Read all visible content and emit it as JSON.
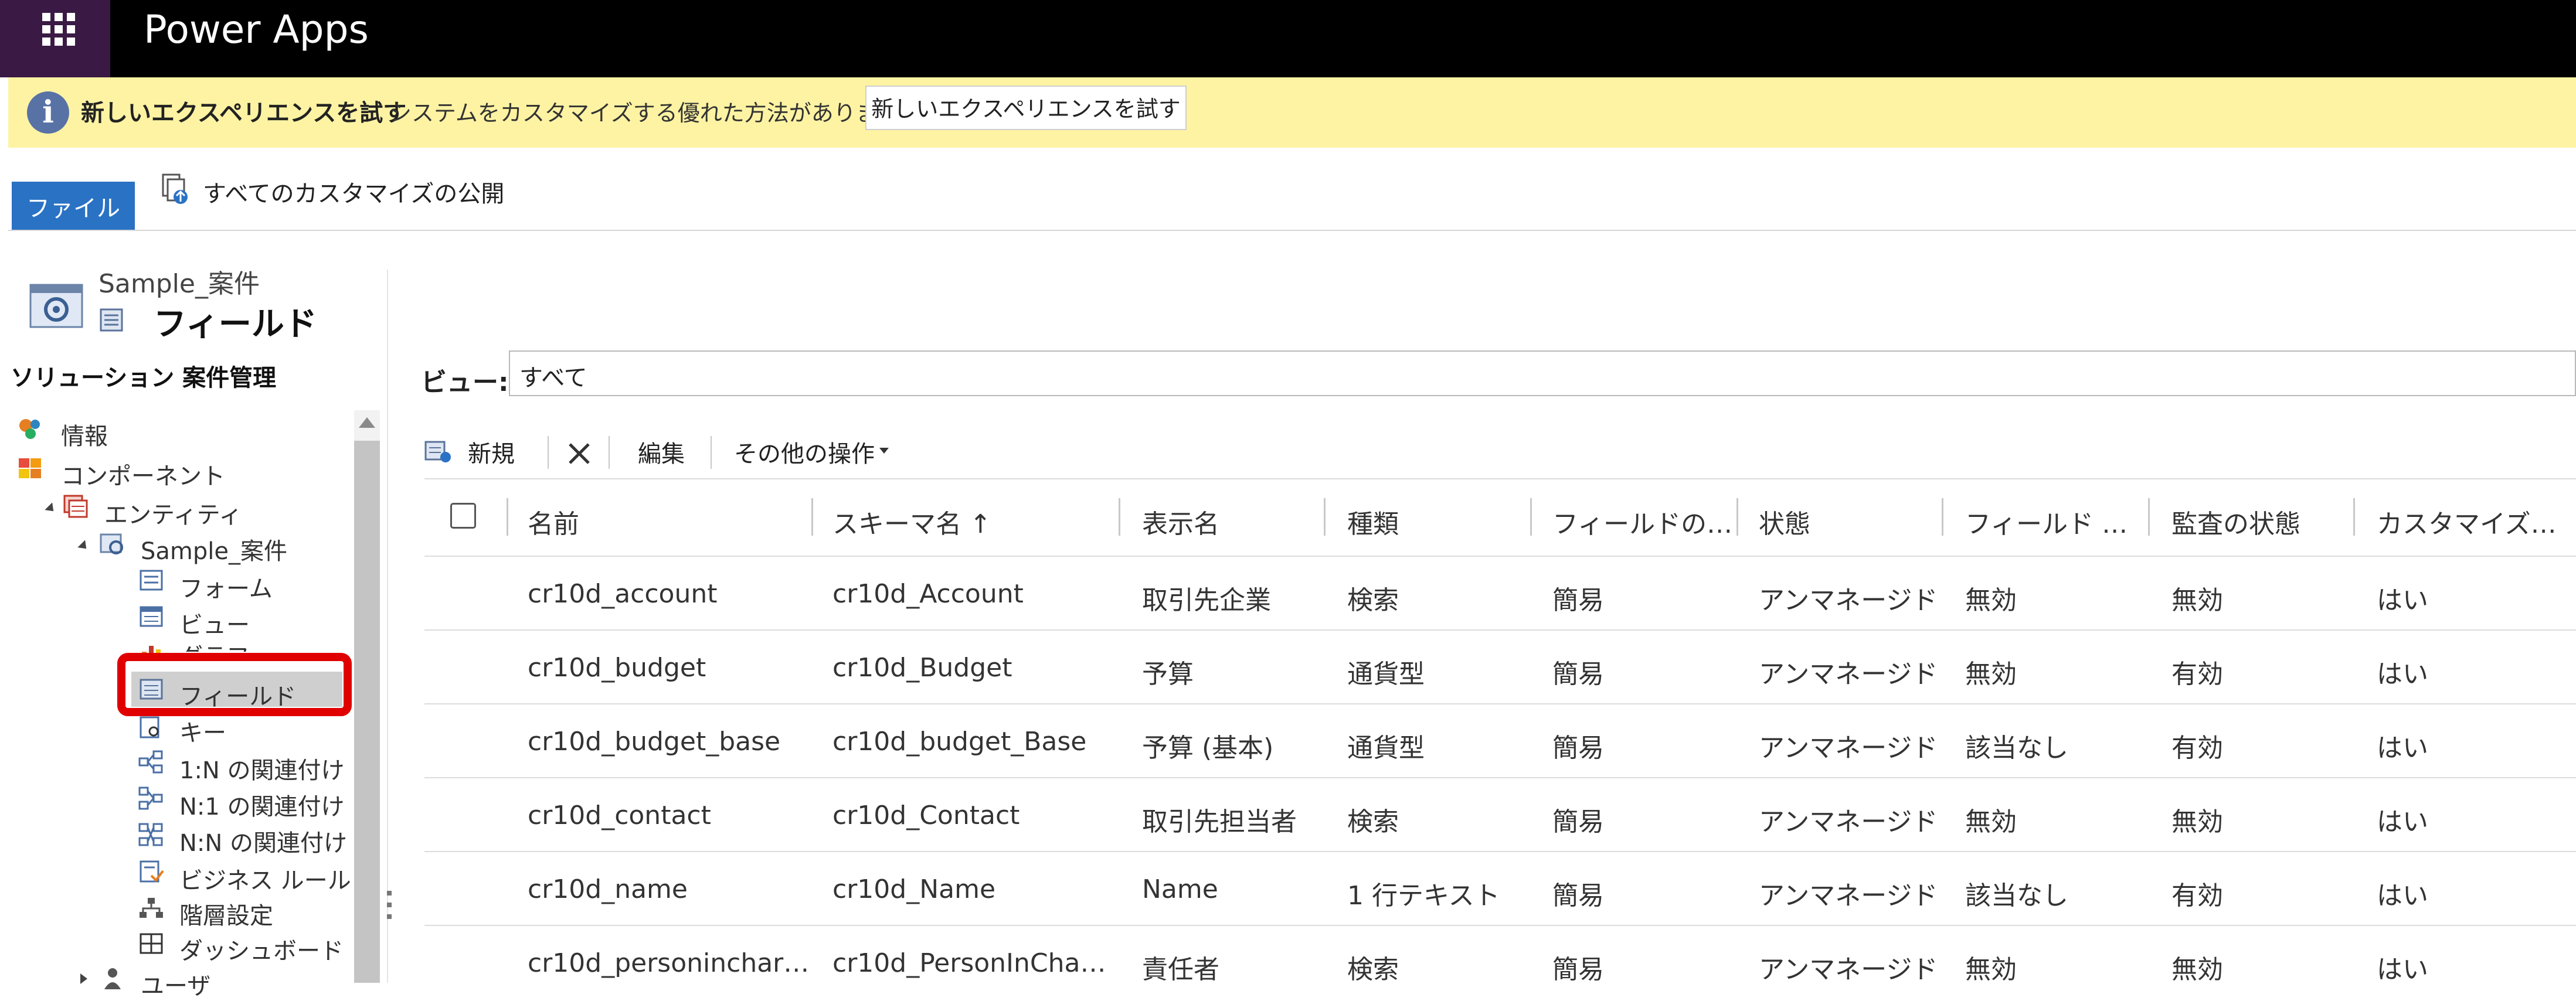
{
  "app": {
    "title": "Power Apps"
  },
  "banner": {
    "title": "新しいエクスペリエンスを試す",
    "text": "システムをカスタマイズする優れた方法があります",
    "button": "新しいエクスペリエンスを試す"
  },
  "ribbon": {
    "file_tab": "ファイル",
    "publish_all": "すべてのカスタマイズの公開"
  },
  "sidebar": {
    "entity_name": "Sample_案件",
    "node_title": "フィールド",
    "solution_label": "ソリューション 案件管理",
    "items": [
      {
        "label": "情報",
        "icon": "info-icon"
      },
      {
        "label": "コンポーネント",
        "icon": "components-icon"
      },
      {
        "label": "エンティティ",
        "icon": "entities-icon"
      },
      {
        "label": "Sample_案件",
        "icon": "entity-icon"
      },
      {
        "label": "フォーム",
        "icon": "form-icon"
      },
      {
        "label": "ビュー",
        "icon": "view-icon"
      },
      {
        "label": "グラフ",
        "icon": "chart-icon"
      },
      {
        "label": "フィールド",
        "icon": "field-icon"
      },
      {
        "label": "キー",
        "icon": "key-icon"
      },
      {
        "label": "1:N の関連付け",
        "icon": "relationship-1n-icon"
      },
      {
        "label": "N:1 の関連付け",
        "icon": "relationship-n1-icon"
      },
      {
        "label": "N:N の関連付け",
        "icon": "relationship-nn-icon"
      },
      {
        "label": "ビジネス ルール",
        "icon": "business-rule-icon"
      },
      {
        "label": "階層設定",
        "icon": "hierarchy-icon"
      },
      {
        "label": "ダッシュボード",
        "icon": "dashboard-icon"
      },
      {
        "label": "ユーザ",
        "icon": "user-icon"
      }
    ]
  },
  "main": {
    "view_label": "ビュー:",
    "view_value": "すべて",
    "toolbar": {
      "new": "新規",
      "delete_icon": "delete-icon",
      "edit": "編集",
      "more": "その他の操作"
    },
    "columns": [
      "名前",
      "スキーマ名 ↑",
      "表示名",
      "種類",
      "フィールドの…",
      "状態",
      "フィールド …",
      "監査の状態",
      "カスタマイズ…"
    ],
    "rows": [
      [
        "cr10d_account",
        "cr10d_Account",
        "取引先企業",
        "検索",
        "簡易",
        "アンマネージド",
        "無効",
        "無効",
        "はい"
      ],
      [
        "cr10d_budget",
        "cr10d_Budget",
        "予算",
        "通貨型",
        "簡易",
        "アンマネージド",
        "無効",
        "有効",
        "はい"
      ],
      [
        "cr10d_budget_base",
        "cr10d_budget_Base",
        "予算 (基本)",
        "通貨型",
        "簡易",
        "アンマネージド",
        "該当なし",
        "有効",
        "はい"
      ],
      [
        "cr10d_contact",
        "cr10d_Contact",
        "取引先担当者",
        "検索",
        "簡易",
        "アンマネージド",
        "無効",
        "無効",
        "はい"
      ],
      [
        "cr10d_name",
        "cr10d_Name",
        "Name",
        "1 行テキスト",
        "簡易",
        "アンマネージド",
        "該当なし",
        "有効",
        "はい"
      ],
      [
        "cr10d_personinchar…",
        "cr10d_PersonInCha…",
        "責任者",
        "検索",
        "簡易",
        "アンマネージド",
        "無効",
        "無効",
        "はい"
      ]
    ]
  }
}
